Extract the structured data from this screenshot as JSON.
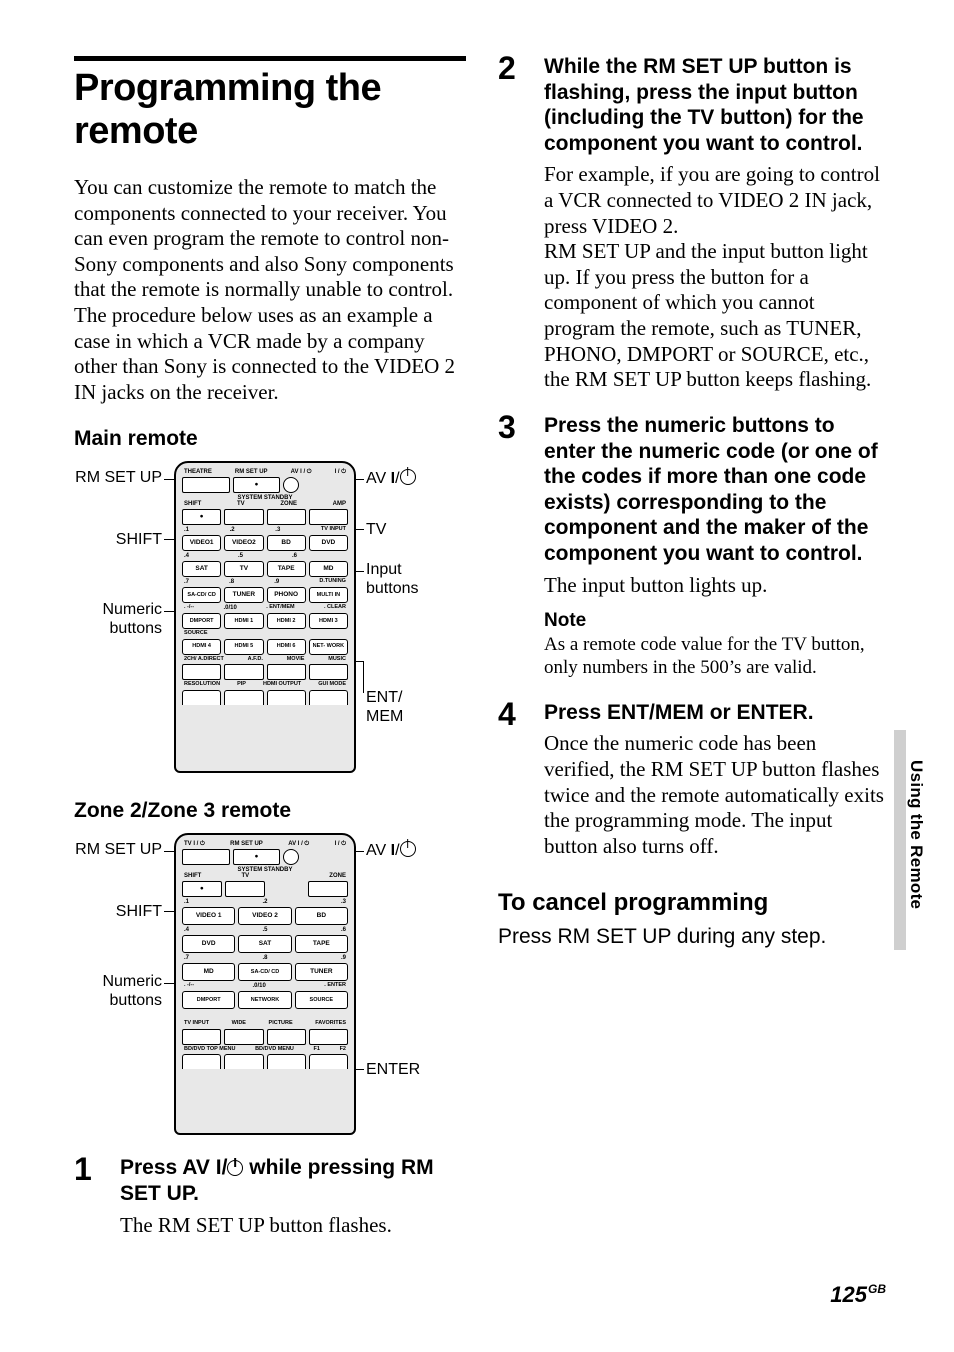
{
  "title": "Programming the remote",
  "intro": "You can customize the remote to match the components connected to your receiver. You can even program the remote to control non-Sony components and also Sony components that the remote is normally unable to control. The procedure below uses as an example a case in which a VCR made by a company other than Sony is connected to the VIDEO 2 IN jacks on the receiver.",
  "main_remote_h": "Main remote",
  "zone_remote_h": "Zone 2/Zone 3 remote",
  "labels": {
    "rm_set_up": "RM SET UP",
    "shift": "SHIFT",
    "numeric": "Numeric buttons",
    "av_power_prefix": "AV ",
    "av_power_i": "I",
    "av_power_slash": "/",
    "tv": "TV",
    "input_buttons": "Input buttons",
    "ent_mem": "ENT/ MEM",
    "enter": "ENTER"
  },
  "remote1": {
    "top_labels": [
      "THEATRE",
      "RM SET UP",
      "AV",
      "/"
    ],
    "standby": "SYSTEM STANDBY",
    "sel_row": [
      "SHIFT",
      "TV",
      "ZONE",
      "AMP"
    ],
    "numrow1": [
      ".1",
      ".2",
      ".3",
      "TV INPUT"
    ],
    "inrow1": [
      "VIDEO1",
      "VIDEO2",
      "BD",
      "DVD"
    ],
    "numrow2": [
      ".4",
      ".5",
      ".6",
      ""
    ],
    "inrow2": [
      "SAT",
      "TV",
      "TAPE",
      "MD"
    ],
    "numrow3": [
      ".7",
      ".8",
      ".9",
      "D.TUNING"
    ],
    "inrow3": [
      "SA-CD/ CD",
      "TUNER",
      "PHONO",
      "MULTI IN"
    ],
    "numrow4": [
      ". -/--",
      ".0/10",
      ". ENT/MEM",
      ". CLEAR"
    ],
    "inrow4": [
      "DMPORT",
      "HDMI 1",
      "HDMI 2",
      "HDMI 3"
    ],
    "numrow5": [
      "",
      "",
      "",
      ""
    ],
    "inrow5": [
      "HDMI 4",
      "HDMI 5",
      "HDMI 6",
      "NET- WORK"
    ],
    "inrow5b": [
      "SOURCE",
      "",
      "",
      ""
    ],
    "mode_labels": [
      "2CH/ A.DIRECT",
      "A.F.D.",
      "MOVIE",
      "MUSIC"
    ],
    "bottom_labels": [
      "RESOLUTION",
      "PIP",
      "HDMI OUTPUT",
      "GUI MODE"
    ]
  },
  "remote2": {
    "top_labels": [
      "TV I /",
      "RM SET UP",
      "AV",
      "/"
    ],
    "standby": "SYSTEM STANDBY",
    "sel_row": [
      "SHIFT",
      "TV",
      "",
      "ZONE"
    ],
    "numrow1": [
      ".1",
      ".2",
      ".3"
    ],
    "inrow1": [
      "VIDEO 1",
      "VIDEO 2",
      "BD"
    ],
    "numrow2": [
      ".4",
      ".5",
      ".6"
    ],
    "inrow2": [
      "DVD",
      "SAT",
      "TAPE"
    ],
    "numrow3": [
      ".7",
      ".8",
      ".9"
    ],
    "inrow3": [
      "MD",
      "SA-CD/ CD",
      "TUNER"
    ],
    "numrow4": [
      ". -/--",
      ".0/10",
      ". ENTER"
    ],
    "inrow4": [
      "DMPORT",
      "NETWORK",
      "SOURCE"
    ],
    "bottom_labels": [
      "TV INPUT",
      "WIDE",
      "PICTURE",
      "FAVORITES"
    ],
    "bottom_labels2": [
      "BD/DVD TOP MENU",
      "BD/DVD MENU",
      "F1",
      "F2"
    ]
  },
  "steps": {
    "s1": {
      "num": "1",
      "head_pre": "Press AV ",
      "head_i": "I",
      "head_slash": "/",
      "head_post": " while pressing RM SET UP.",
      "text": "The RM SET UP button flashes."
    },
    "s2": {
      "num": "2",
      "head": "While the RM SET UP button is flashing, press the input button (including the TV button) for the component you want to control.",
      "text": "For example, if you are going to control a VCR connected to VIDEO 2 IN jack, press VIDEO 2.\nRM SET UP and the input button light up. If you press the button for a component of which you cannot program the remote, such as TUNER, PHONO, DMPORT or SOURCE, etc., the RM SET UP button keeps flashing."
    },
    "s3": {
      "num": "3",
      "head": "Press the numeric buttons to enter the numeric code (or one of the codes if more than one code exists) corresponding to the component and the maker of the component you want to control.",
      "text": "The input button lights up.",
      "note_h": "Note",
      "note_t": "As a remote code value for the TV button, only numbers in the 500’s are valid."
    },
    "s4": {
      "num": "4",
      "head": "Press ENT/MEM or ENTER.",
      "text": "Once the numeric code has been verified, the RM SET UP button flashes twice and the remote automatically exits the programming mode. The input button also turns off."
    }
  },
  "cancel_h": "To cancel programming",
  "cancel_t": "Press RM SET UP during any step.",
  "side_tab": "Using the Remote",
  "page_number": "125",
  "page_region": "GB"
}
